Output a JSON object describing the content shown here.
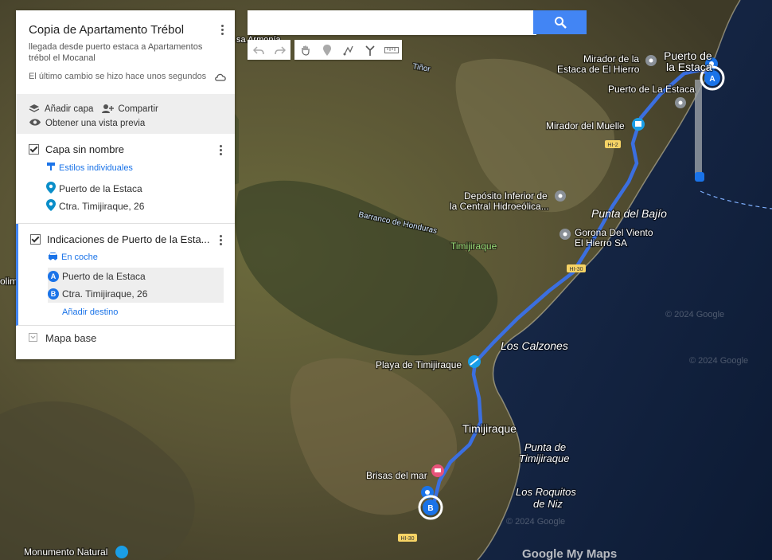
{
  "colors": {
    "route": "#3b6fe0",
    "accent": "#4285f4",
    "link": "#1a73e8",
    "sea": "#0f1e3a"
  },
  "panel": {
    "title": "Copia de Apartamento Trébol",
    "description": "llegada desde puerto estaca a Apartamentos trébol el Mocanal",
    "last_change": "El último cambio se hizo hace unos segundos",
    "actions": {
      "add_layer": "Añadir capa",
      "share": "Compartir",
      "preview": "Obtener una vista previa"
    },
    "layer1": {
      "title": "Capa sin nombre",
      "style_link": "Estilos individuales",
      "items": [
        "Puerto de la Estaca",
        "Ctra. Timijiraque, 26"
      ]
    },
    "layer2": {
      "title": "Indicaciones de Puerto de la Esta...",
      "mode": "En coche",
      "stops": [
        {
          "badge": "A",
          "label": "Puerto de la Estaca"
        },
        {
          "badge": "B",
          "label": "Ctra. Timijiraque, 26"
        }
      ],
      "add_destination": "Añadir destino"
    },
    "basemap": "Mapa base"
  },
  "search": {
    "value": "",
    "icon": "search-icon"
  },
  "map": {
    "labels": {
      "puerto1": "Puerto de",
      "puerto2": "la Estaca",
      "mirador1": "Mirador de la",
      "mirador2": "Estaca de El Hierro",
      "puerto_estaca": "Puerto de La Estaca",
      "mirador_muelle": "Mirador del Muelle",
      "deposito1": "Depósito Inferior de",
      "deposito2": "la Central Hidroeólica...",
      "punta_bajio": "Punta del Bajío",
      "gorona1": "Gorona Del Viento",
      "gorona2": "El Hierro SA",
      "barranco": "Barranco de Honduras",
      "timijiraque_area": "Timijiraque",
      "los_calzones": "Los Calzones",
      "playa": "Playa de Timijiraque",
      "timijiraque": "Timijiraque",
      "punta_tim1": "Punta de",
      "punta_tim2": "Timijiraque",
      "brisas": "Brisas del mar",
      "roquitos1": "Los Roquitos",
      "roquitos2": "de Niz",
      "monumento": "Monumento Natural",
      "sa_armonia": "sa Armonía",
      "tinor": "Tiñor",
      "olim": "olim",
      "road_hi2": "HI-2",
      "road_hi30a": "HI-30",
      "road_hi30b": "HI-30",
      "marker_a": "A",
      "marker_b": "B",
      "watermark": "© 2024 Google",
      "watermark2": "© 2024 Google",
      "watermark3": "© 2024 Google",
      "logo": "Google My Maps"
    }
  }
}
